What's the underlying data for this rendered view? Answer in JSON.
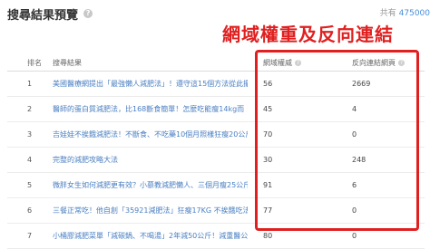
{
  "header": {
    "title": "搜尋結果預覽",
    "info_icon": "?",
    "total_label": "共有",
    "total_value": "475000"
  },
  "banner": {
    "text": "網域權重及反向連結",
    "color": "#e02020"
  },
  "table": {
    "columns": {
      "rank": "排名",
      "result": "搜尋結果",
      "authority": "網域權威",
      "backlinks": "反向連結網頁"
    },
    "rows": [
      {
        "rank": "1",
        "result": "美國醫療網提出「最強懶人減肥法」！遵守這15個方法從此擺脫",
        "authority": "56",
        "backlinks": "2669"
      },
      {
        "rank": "2",
        "result": "醫師的蛋白質減肥法，比168斷食簡單！怎麼吃能瘦14kg而",
        "authority": "45",
        "backlinks": "4"
      },
      {
        "rank": "3",
        "result": "吉娃娃不挨餓減肥法！不斷食、不吃藥10個月照樣狂瘦20公斤",
        "authority": "70",
        "backlinks": "0"
      },
      {
        "rank": "4",
        "result": "完整的減肥攻略大法",
        "authority": "30",
        "backlinks": "248"
      },
      {
        "rank": "5",
        "result": "微胖女生如何減肥更有效？小慕教減肥懶人、三個月瘦25公斤食譜",
        "authority": "91",
        "backlinks": "6"
      },
      {
        "rank": "6",
        "result": "三餐正常吃！他自創「35921減肥法」狂瘦17KG 不挨餓吃法曝光",
        "authority": "77",
        "backlinks": "0"
      },
      {
        "rank": "7",
        "result": "小桶膠減肥菜單「減碳鍋、不喝湯」2年減50公斤！減重醫公開",
        "authority": "80",
        "backlinks": "0"
      }
    ]
  },
  "colors": {
    "accent": "#e02020",
    "link": "#4a7fc1"
  }
}
